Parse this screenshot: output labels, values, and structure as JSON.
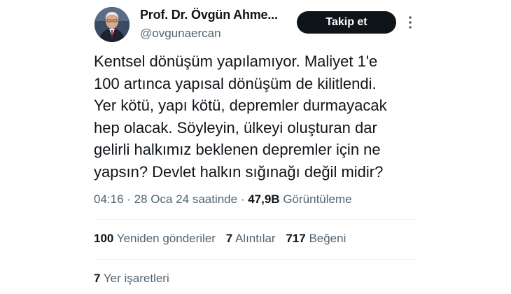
{
  "author": {
    "display_name": "Prof. Dr. Övgün Ahme...",
    "handle": "@ovgunaercan"
  },
  "follow_button_label": "Takip et",
  "tweet_text": "Kentsel dönüşüm yapılamıyor. Maliyet 1'e\n100 artınca yapısal dönüşüm de kilitlendi.\nYer kötü, yapı kötü, depremler durmayacak\nhep olacak. Söyleyin, ülkeyi oluşturan dar\ngelirli halkımız beklenen depremler için ne\nyapsın?  Devlet halkın sığınağı değil midir?",
  "meta": {
    "time": "04:16",
    "separator1": " · ",
    "date": "28 Oca 24 saatinde",
    "separator2": " · ",
    "views_count": "47,9B",
    "views_label": "Görüntüleme"
  },
  "stats": [
    {
      "count": "100",
      "label": "Yeniden gönderiler"
    },
    {
      "count": "7",
      "label": "Alıntılar"
    },
    {
      "count": "717",
      "label": "Beğeni"
    }
  ],
  "bookmarks": {
    "count": "7",
    "label": "Yer işaretleri"
  },
  "icons": {
    "avatar": "profile-photo",
    "more": "more-vertical-icon"
  },
  "colors": {
    "text_primary": "#0f1419",
    "text_secondary": "#536471",
    "button_bg": "#0f1419",
    "button_text": "#ffffff",
    "divider": "#eff3f4"
  }
}
